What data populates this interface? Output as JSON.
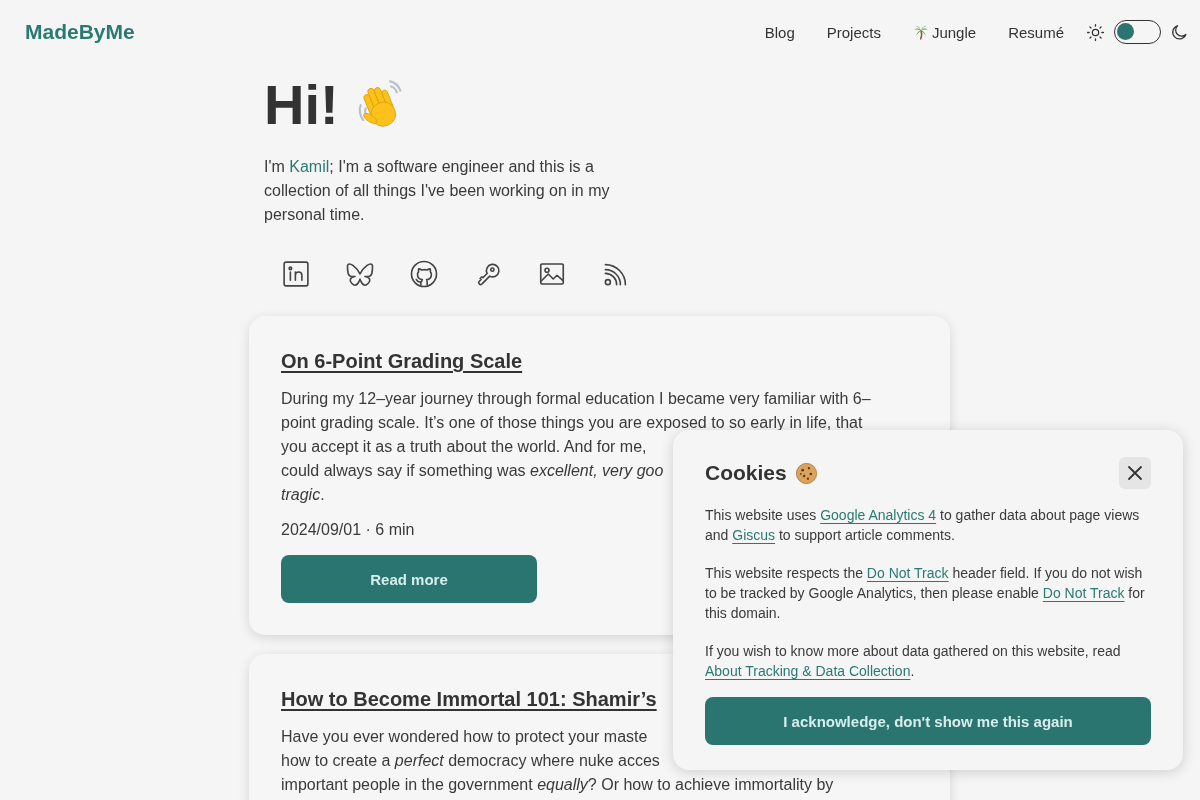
{
  "header": {
    "logo": "MadeByMe",
    "nav": [
      {
        "label": "Blog",
        "kind": "link"
      },
      {
        "label": "Projects",
        "kind": "link"
      },
      {
        "label": "Jungle",
        "kind": "icon_link"
      },
      {
        "label": "Resumé",
        "kind": "link"
      }
    ],
    "dark_mode": false
  },
  "hero": {
    "heading": "Hi!",
    "intro": [
      {
        "kind": "text",
        "text": "I'm "
      },
      {
        "kind": "link",
        "text": "Kamil"
      },
      {
        "kind": "text",
        "text": "; I'm a software engineer and this is a collection of all things I've been working on in my personal time."
      }
    ]
  },
  "posts": [
    {
      "title": "On 6-Point Grading Scale",
      "excerpt_lines": [
        "During my 12–year journey through formal education I became very familiar with 6–",
        "point grading scale. It’s one of those things you are exposed to so early in life, that",
        "you accept it as a truth about the world. And for me,",
        "could always say if something was *excellent, very goo*",
        "*tragic*."
      ],
      "meta": "2024/09/01 · 6 min",
      "button": "Read more"
    },
    {
      "title": "How to Become Immortal 101: Shamir’s",
      "excerpt_lines": [
        "Have you ever wondered how to protect your maste",
        "how to create a *perfect* democracy where nuke acces",
        "important people in the government *equally*? Or how to achieve immortality by"
      ]
    }
  ],
  "cookie_notice": {
    "title": "Cookies",
    "paragraphs": [
      [
        {
          "kind": "text",
          "text": "This website uses "
        },
        {
          "kind": "link",
          "text": "Google Analytics 4"
        },
        {
          "kind": "text",
          "text": " to gather data about page views and "
        },
        {
          "kind": "link",
          "text": "Giscus"
        },
        {
          "kind": "text",
          "text": " to support article comments."
        }
      ],
      [
        {
          "kind": "text",
          "text": "This website respects the "
        },
        {
          "kind": "link",
          "text": "Do Not Track"
        },
        {
          "kind": "text",
          "text": " header field. If you do not wish to be tracked by Google Analytics, then please enable "
        },
        {
          "kind": "link",
          "text": "Do Not Track"
        },
        {
          "kind": "text",
          "text": " for this domain."
        }
      ],
      [
        {
          "kind": "text",
          "text": "If you wish to know more about data gathered on this website, read "
        },
        {
          "kind": "link",
          "text": "About Tracking & Data Collection"
        },
        {
          "kind": "text",
          "text": "."
        }
      ]
    ],
    "button": "I acknowledge, don't show me this again"
  }
}
